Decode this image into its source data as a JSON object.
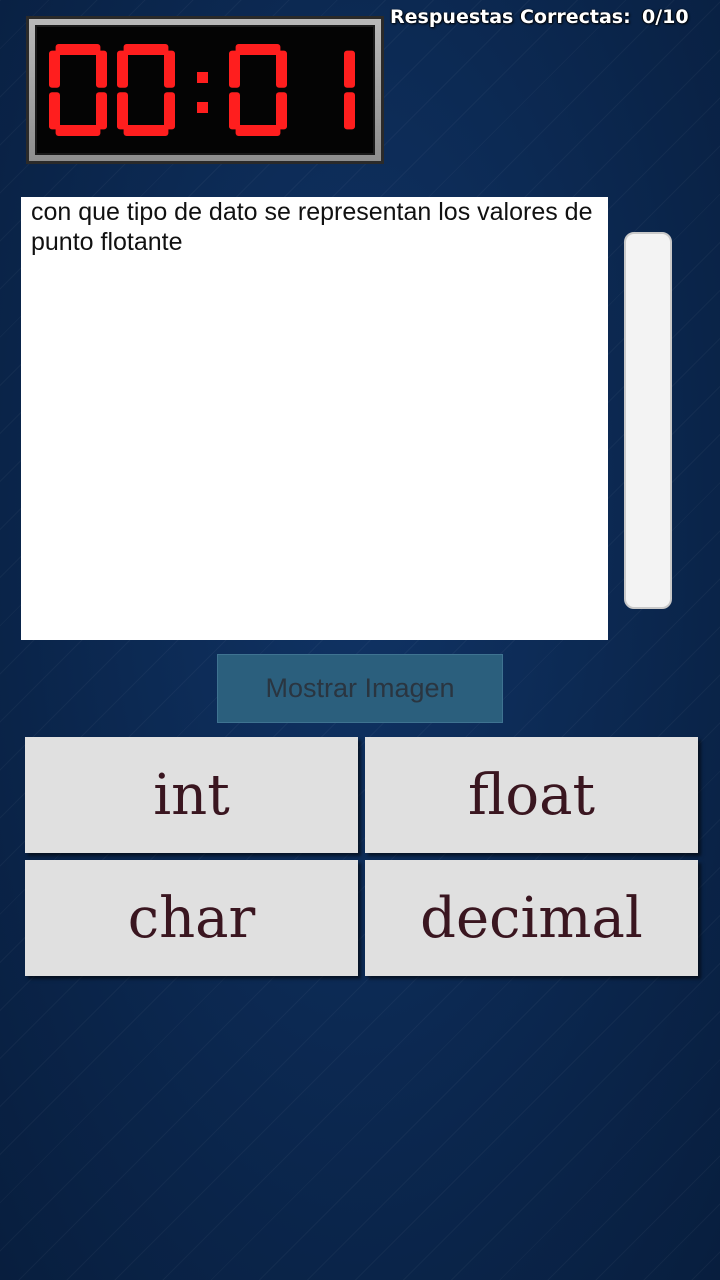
{
  "timer": {
    "minutes": "00",
    "seconds": "01",
    "digit_color": "#ff1e1e"
  },
  "score": {
    "label": "Respuestas Correctas:",
    "value": "0/10"
  },
  "question": {
    "text": "con que tipo de dato se representan los valores de punto flotante"
  },
  "show_image_button": {
    "label": "Mostrar Imagen"
  },
  "answers": [
    {
      "label": "int"
    },
    {
      "label": "float"
    },
    {
      "label": "char"
    },
    {
      "label": "decimal"
    }
  ]
}
